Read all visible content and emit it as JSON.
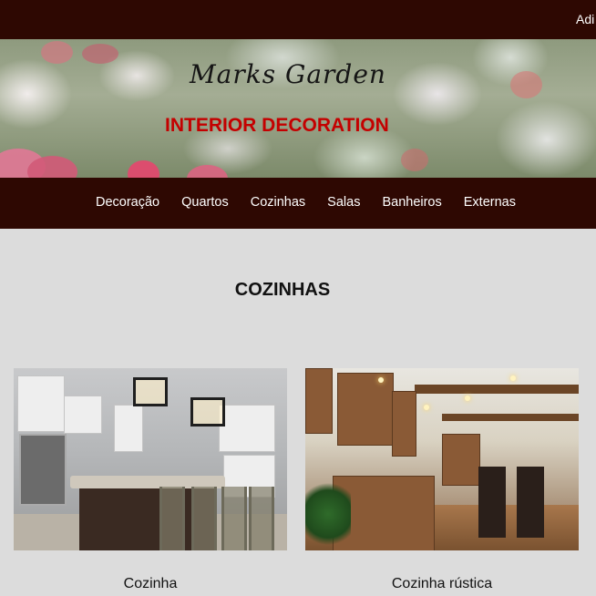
{
  "header": {
    "top_link_partial": "Adi"
  },
  "hero": {
    "brand": "Marks Garden",
    "tagline": "INTERIOR DECORATION"
  },
  "nav": {
    "items": [
      "Decoração",
      "Quartos",
      "Cozinhas",
      "Salas",
      "Banheiros",
      "Externas"
    ]
  },
  "main": {
    "section_title": "COZINHAS",
    "cards": [
      {
        "caption": "Cozinha",
        "image": "kitchen-photo"
      },
      {
        "caption": "Cozinha rústica",
        "image": "rustic-kitchen-photo"
      }
    ]
  },
  "colors": {
    "bar_bg": "#2e0802",
    "page_bg": "#dcdcdc",
    "tagline": "#c40000"
  }
}
